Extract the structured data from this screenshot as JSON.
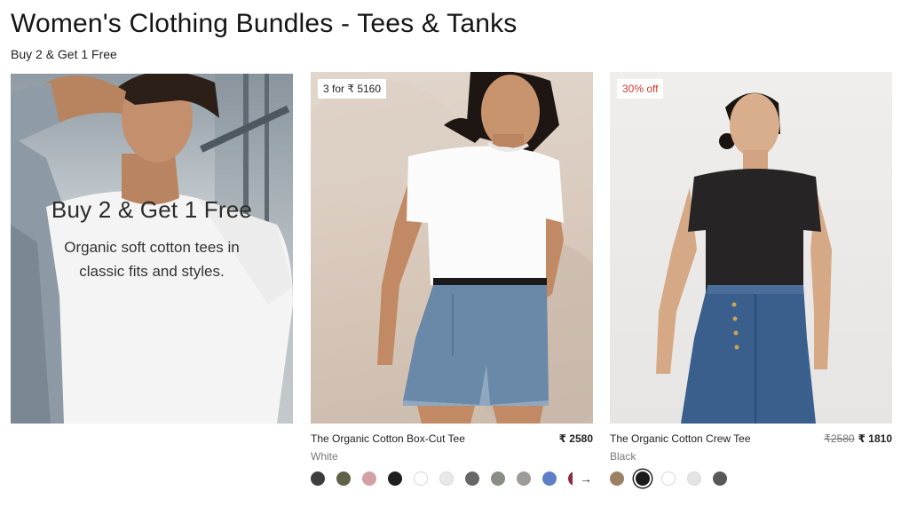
{
  "header": {
    "title": "Women's Clothing Bundles - Tees & Tanks",
    "subtitle": "Buy 2 & Get 1 Free"
  },
  "hero": {
    "title": "Buy 2 & Get 1 Free",
    "body": "Organic soft cotton tees in classic fits and styles."
  },
  "products": [
    {
      "badge": "3 for ₹ 5160",
      "name": "The Organic Cotton Box-Cut Tee",
      "color": "White",
      "price": "₹ 2580",
      "swatches": [
        "#3d3d3d",
        "#5f6149",
        "#d3a0a3",
        "#1f1f1f",
        "#ffffff",
        "#e8e8e8",
        "#676767",
        "#8a8d85",
        "#9d9b97",
        "#5c7fc8"
      ],
      "partial_swatch": "#8c2a3e",
      "next_icon": "arrow-right-icon",
      "next_glyph": "→"
    },
    {
      "badge": "30% off",
      "name": "The Organic Cotton Crew Tee",
      "color": "Black",
      "price_old": "₹2580",
      "price": "₹ 1810",
      "swatches": [
        "#9c8064",
        "#1c1c1c",
        "#ffffff",
        "#e4e4e4",
        "#585858"
      ],
      "selected_swatch_index": 1
    }
  ],
  "colors": {
    "sale_red": "#d33a2c"
  }
}
